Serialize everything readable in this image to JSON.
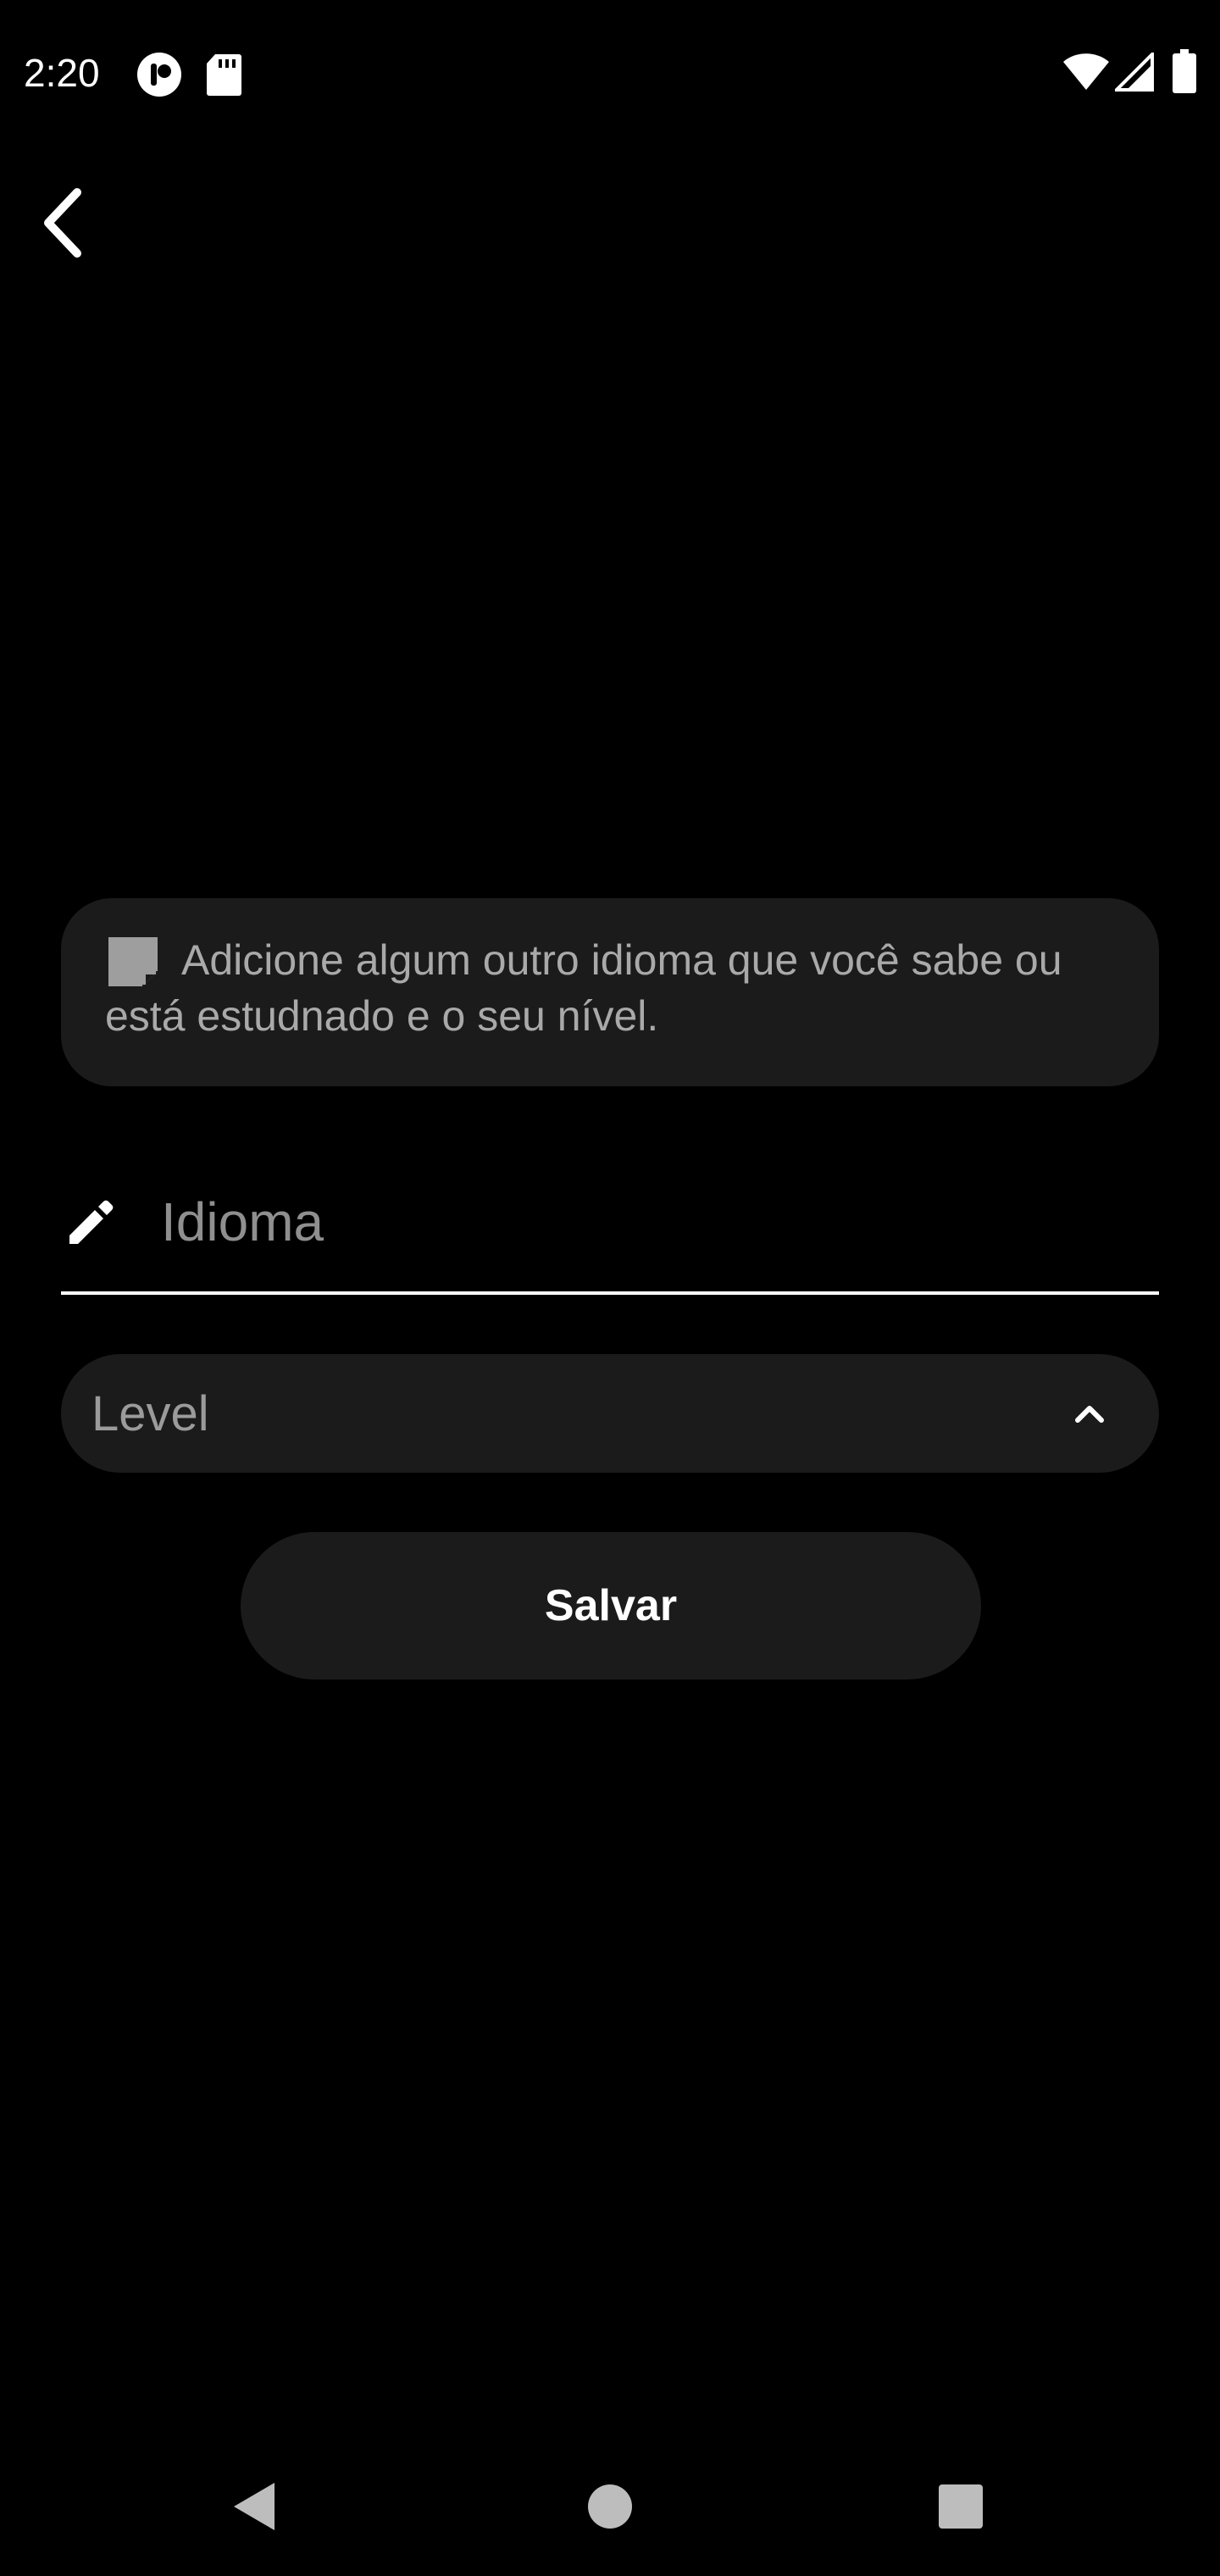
{
  "status_bar": {
    "time": "2:20",
    "left_icons": [
      "notification-app-icon",
      "sd-card-icon"
    ],
    "right_icons": [
      "wifi-icon",
      "cell-signal-icon",
      "battery-icon"
    ]
  },
  "header": {
    "back_icon": "chevron-left-icon"
  },
  "info_card": {
    "icon": "note-icon",
    "text": "Adicione algum outro idioma que você sabe ou está estudnado e o seu nível."
  },
  "idioma_field": {
    "icon": "pencil-icon",
    "placeholder": "Idioma",
    "value": ""
  },
  "level_select": {
    "label": "Level",
    "icon": "chevron-up-icon"
  },
  "save_button": {
    "label": "Salvar"
  },
  "nav_bar": {
    "back_icon": "nav-back-icon",
    "home_icon": "nav-home-icon",
    "recents_icon": "nav-recents-icon"
  },
  "colors": {
    "background": "#000000",
    "surface": "#1b1b1b",
    "text_primary": "#ffffff",
    "text_secondary": "#a9a9a9"
  }
}
